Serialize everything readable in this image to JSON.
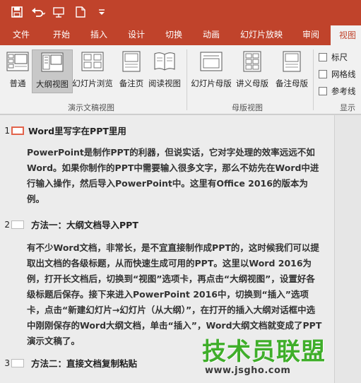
{
  "ribbon_tabs": [
    "文件",
    "开始",
    "插入",
    "设计",
    "切换",
    "动画",
    "幻灯片放映",
    "审阅",
    "视图"
  ],
  "active_tab": "视图",
  "groups": {
    "presentation_views": {
      "label": "演示文稿视图",
      "buttons": [
        "普通",
        "大纲视图",
        "幻灯片浏览",
        "备注页",
        "阅读视图"
      ]
    },
    "master_views": {
      "label": "母版视图",
      "buttons": [
        "幻灯片母版",
        "讲义母版",
        "备注母版"
      ]
    },
    "show": {
      "label": "显示",
      "checkboxes": [
        "标尺",
        "网格线",
        "参考线"
      ]
    }
  },
  "selected_view": "大纲视图",
  "outline": {
    "slides": [
      {
        "number": "1",
        "title": "Word里写字在PPT里用",
        "body": "PowerPoint是制作PPT的利器，但说实话，它对字处理的效率远远不如Word。如果你制作的PPT中需要输入很多文字，那么不妨先在Word中进行输入操作，然后导入PowerPoint中。这里有Office 2016的版本为例。"
      },
      {
        "number": "2",
        "title": "方法一：大纲文档导入PPT",
        "body": "有不少Word文档，非常长，是不宜直接制作成PPT的，这时候我们可以提取出文档的各级标题，从而快速生成可用的PPT。这里以Word 2016为例，打开长文档后，切换到“视图”选项卡，再点击“大纲视图”，设置好各级标题后保存。接下来进入PowerPoint 2016中，切换到“插入”选项卡，点击“新建幻灯片→幻灯片（从大纲）”，在打开的插入大纲对话框中选中刚刚保存的Word大纲文档，单击“插入”，Word大纲文档就变成了PPT演示文稿了。"
      },
      {
        "number": "3",
        "title": "方法二：直接文档复制粘贴",
        "body": ""
      }
    ]
  },
  "watermark": {
    "title": "技术员联盟",
    "url": "www.jsgho.com"
  }
}
